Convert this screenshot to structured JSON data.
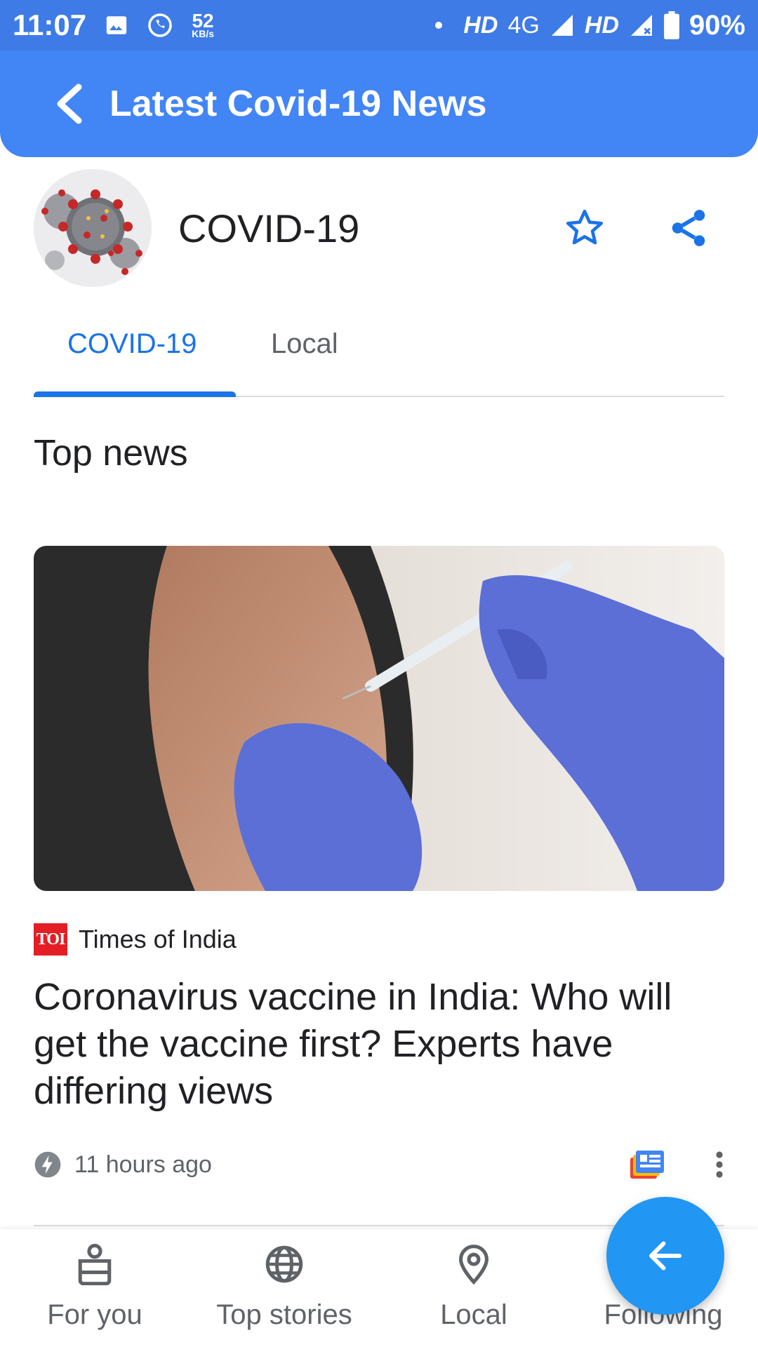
{
  "status_bar": {
    "time": "11:07",
    "net_speed_value": "52",
    "net_speed_unit": "KB/s",
    "network_1": "HD",
    "network_type": "4G",
    "network_2": "HD",
    "battery": "90%"
  },
  "app_bar": {
    "title": "Latest Covid-19 News",
    "back_icon": "chevron-left-icon"
  },
  "topic": {
    "title": "COVID-19",
    "follow_icon": "star-outline-icon",
    "share_icon": "share-icon"
  },
  "tabs": [
    {
      "label": "COVID-19",
      "active": true
    },
    {
      "label": "Local",
      "active": false
    }
  ],
  "section": {
    "title": "Top news"
  },
  "story": {
    "source_logo": "TOI",
    "source_name": "Times of India",
    "headline": "Coronavirus vaccine in India: Who will get the vaccine first? Experts have differing views",
    "time": "11 hours ago",
    "time_icon": "bolt-icon",
    "full_coverage_icon": "full-coverage-icon",
    "more_icon": "more-vertical-icon"
  },
  "bottom_nav": [
    {
      "label": "For you",
      "icon": "person-card-icon"
    },
    {
      "label": "Top stories",
      "icon": "globe-icon"
    },
    {
      "label": "Local",
      "icon": "location-pin-icon"
    },
    {
      "label": "Following",
      "icon": "star-icon"
    }
  ],
  "fab": {
    "icon": "arrow-left-icon"
  },
  "colors": {
    "status_bar": "#3e7be6",
    "app_bar": "#4285f4",
    "accent": "#1a73e8",
    "fab": "#2196f3",
    "toi_red": "#e31e24"
  }
}
